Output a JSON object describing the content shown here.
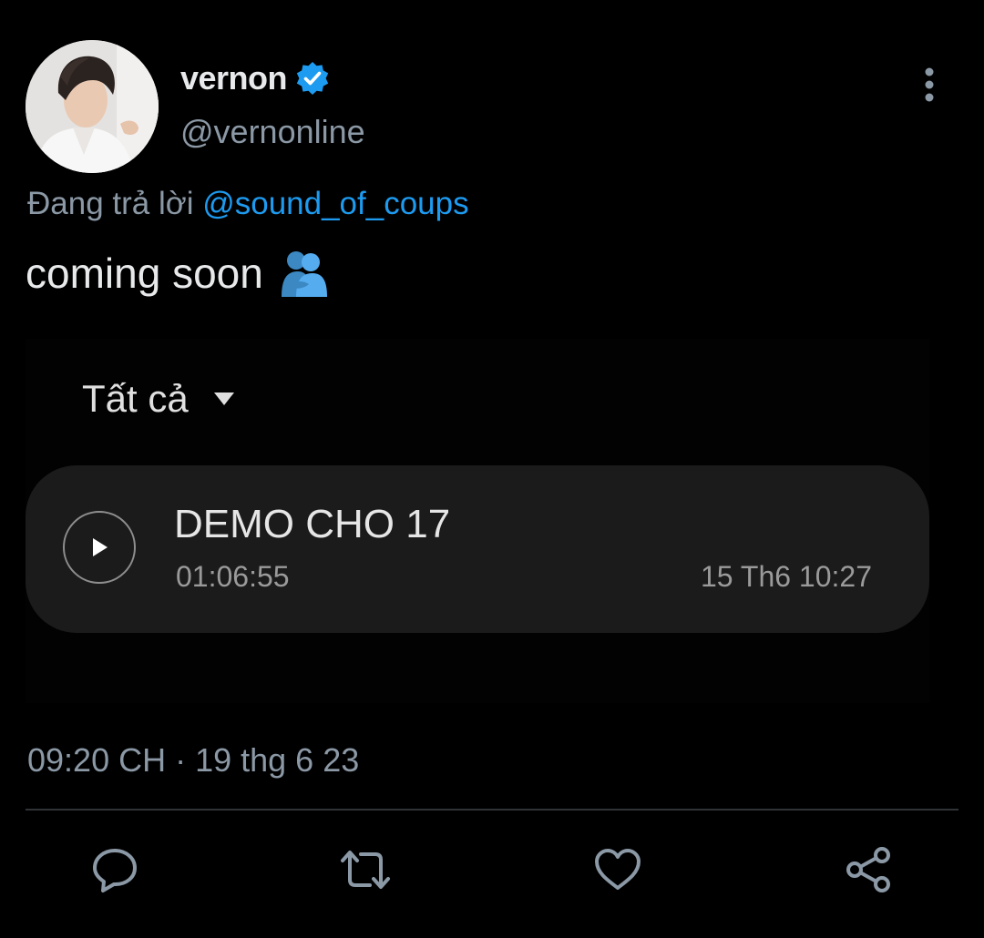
{
  "author": {
    "display_name": "vernon",
    "handle": "@vernonline",
    "verified": true,
    "avatar_icon": "user-avatar-photo"
  },
  "reply": {
    "prefix": "Đang trả lời",
    "mention": "@sound_of_coups"
  },
  "tweet": {
    "text": "coming soon",
    "emoji": "people-hugging-emoji"
  },
  "media": {
    "filter_label": "Tất cả",
    "recording": {
      "title": "DEMO CHO 17",
      "duration": "01:06:55",
      "date": "15 Th6 10:27"
    }
  },
  "timestamp": "09:20 CH · 19 thg 6 23",
  "actions": {
    "reply_icon": "comment-icon",
    "retweet_icon": "retweet-icon",
    "like_icon": "heart-icon",
    "share_icon": "share-icon"
  },
  "colors": {
    "background": "#000000",
    "text": "#e7e9ea",
    "secondary": "#8b98a5",
    "accent": "#1d9bf0",
    "card": "#1b1b1b"
  }
}
